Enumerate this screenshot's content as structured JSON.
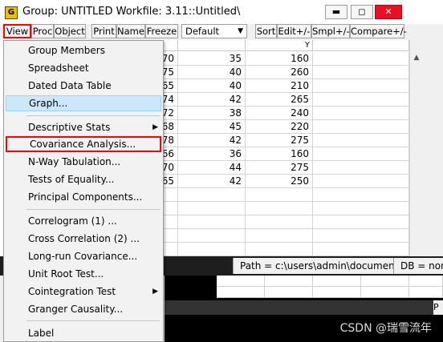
{
  "window": {
    "icon_letter": "G",
    "title": "Group: UNTITLED    Workfile: 3.11::Untitled\\",
    "min_glyph": "▬",
    "max_glyph": "◻",
    "close_glyph": "✕"
  },
  "toolbar": {
    "view": "View",
    "proc": "Proc",
    "object": "Object",
    "print": "Print",
    "name": "Name",
    "freeze": "Freeze",
    "default_value": "Default",
    "sort": "Sort",
    "edit": "Edit+/-",
    "smpl": "Smpl+/-",
    "compare": "Compare+/-"
  },
  "sheet": {
    "headers": [
      "",
      "",
      "Y"
    ],
    "col1_partial": [
      "70",
      "75",
      "65",
      "74",
      "72",
      "68",
      "78",
      "66",
      "70",
      "65"
    ],
    "col2": [
      "35",
      "40",
      "40",
      "42",
      "38",
      "45",
      "42",
      "36",
      "44",
      "42"
    ],
    "col3": [
      "160",
      "260",
      "210",
      "265",
      "240",
      "220",
      "275",
      "160",
      "275",
      "250"
    ]
  },
  "statusbar": {
    "path": "Path = c:\\users\\admin\\documents",
    "db": "DB = none"
  },
  "menu": {
    "items": [
      {
        "label": "Group Members"
      },
      {
        "label": "Spreadsheet"
      },
      {
        "label": "Dated Data Table"
      },
      {
        "label": "Graph..."
      },
      {
        "label": "Descriptive Stats"
      },
      {
        "label": "Covariance Analysis..."
      },
      {
        "label": "N-Way Tabulation..."
      },
      {
        "label": "Tests of Equality..."
      },
      {
        "label": "Principal Components..."
      },
      {
        "label": "Correlogram (1) ..."
      },
      {
        "label": "Cross Correlation (2) ..."
      },
      {
        "label": "Long-run Covariance..."
      },
      {
        "label": "Unit Root Test..."
      },
      {
        "label": "Cointegration Test"
      },
      {
        "label": "Granger Causality..."
      },
      {
        "label": "Label"
      }
    ]
  },
  "lower": {
    "tab_letter": "P"
  },
  "watermark": "CSDN @瑞雪流年",
  "colors": {
    "highlight": "#cce8ff",
    "annotation_red": "#ff0000",
    "close_red": "#e81123"
  }
}
